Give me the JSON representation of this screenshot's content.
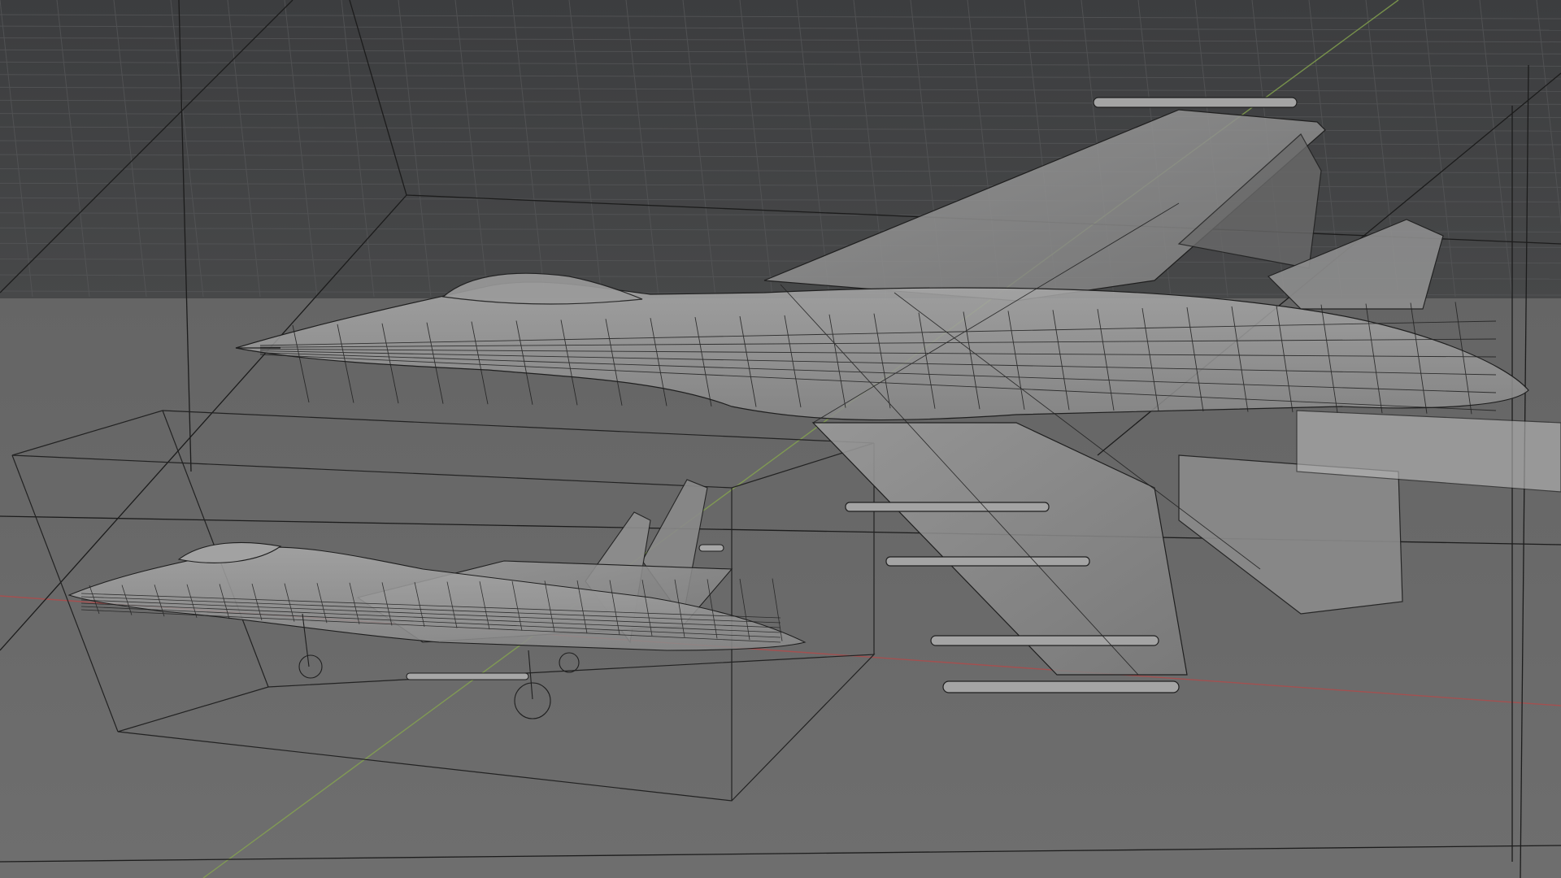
{
  "viewport": {
    "mode": "wireframe-xray",
    "colors": {
      "background_far": "#3f4042",
      "background_floor": "#6b6b6b",
      "grid_line": "#5a5b5d",
      "axis_x": "#b24a4a",
      "axis_y": "#7fa04a",
      "wire": "#1f1f1f",
      "object_fill": "#9a9a9a"
    }
  },
  "objects": [
    {
      "name": "fighter-jet-large",
      "type": "mesh",
      "pose": "in-flight"
    },
    {
      "name": "fighter-jet-small",
      "type": "mesh",
      "pose": "landing-gear-down"
    }
  ]
}
